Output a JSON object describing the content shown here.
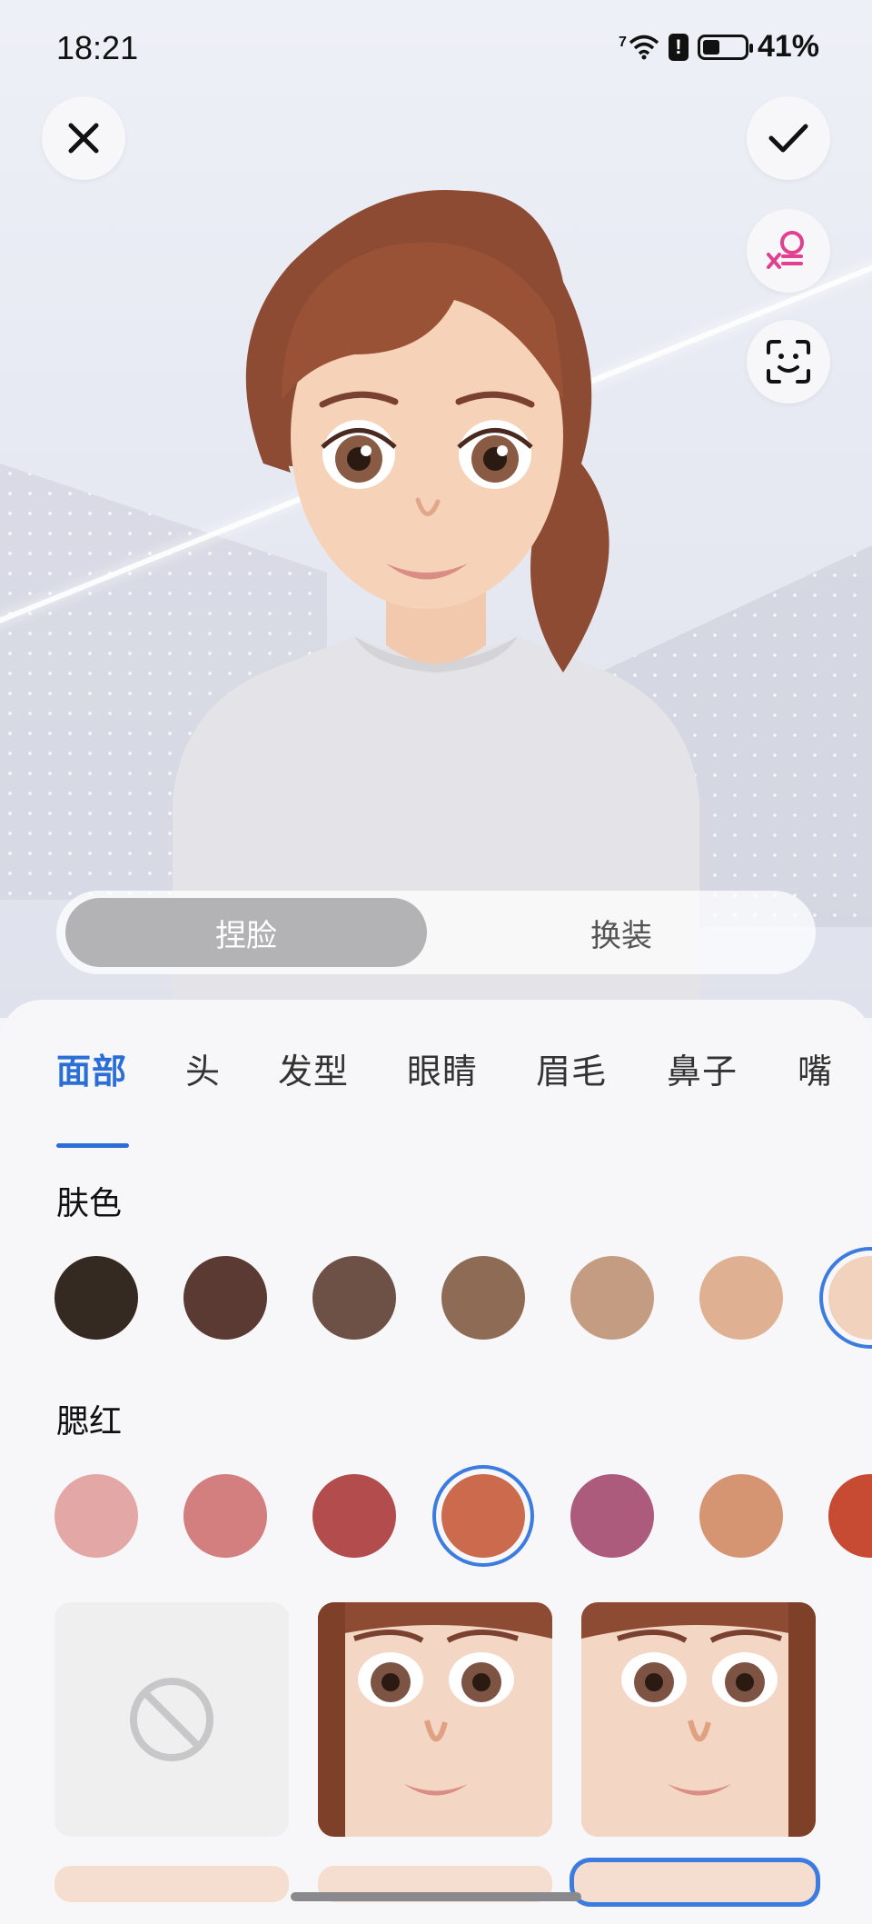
{
  "status_bar": {
    "time": "18:21",
    "network": "7",
    "battery_percent": "41%",
    "battery_level": 0.41
  },
  "actions": {
    "close_icon": "close-icon",
    "confirm_icon": "check-icon",
    "gender_icon": "gender-swap-icon",
    "face_scan_icon": "face-scan-icon"
  },
  "mode_toggle": {
    "active_label": "捏脸",
    "inactive_label": "换装"
  },
  "tabs": [
    "面部",
    "头",
    "发型",
    "眼睛",
    "眉毛",
    "鼻子",
    "嘴"
  ],
  "active_tab": "面部",
  "skin_section": {
    "title": "肤色",
    "colors": [
      "#352a22",
      "#5a3a32",
      "#6e5146",
      "#8e6b55",
      "#c49c82",
      "#dfb092",
      "#f1d3bd"
    ],
    "selected_index": 6
  },
  "blush_section": {
    "title": "腮红",
    "colors": [
      "#e3a8a6",
      "#d37f7f",
      "#b24c4d",
      "#cb6a4d",
      "#ad5b7d",
      "#d59573",
      "#c74a32"
    ],
    "selected_index": 3
  },
  "style_options": {
    "none_icon": "prohibited-icon",
    "preview_icon": "face-preview-icon"
  },
  "colors": {
    "accent": "#2b6fd6"
  }
}
